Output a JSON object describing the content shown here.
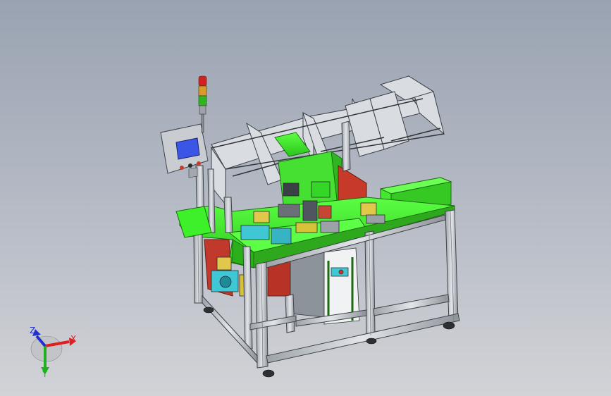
{
  "viewport": {
    "background_top": "#9aa3b2",
    "background_bottom": "#d2d3d7"
  },
  "machine": {
    "frame_color": "#c9cdd2",
    "frame_edge": "#4a4f55",
    "plate_color": "#3ef02a",
    "plate_edge": "#1d6a12",
    "panel_red": "#c73a2a",
    "hmi_screen": "#3b55e6",
    "cyan_parts": "#3fc7d6",
    "tower_light": [
      "red",
      "yellow",
      "green"
    ]
  },
  "triad": {
    "x_label": "X",
    "y_label": "Y",
    "z_label": "Z",
    "x_color": "#e02020",
    "y_color": "#20b020",
    "z_color": "#2030d0"
  }
}
